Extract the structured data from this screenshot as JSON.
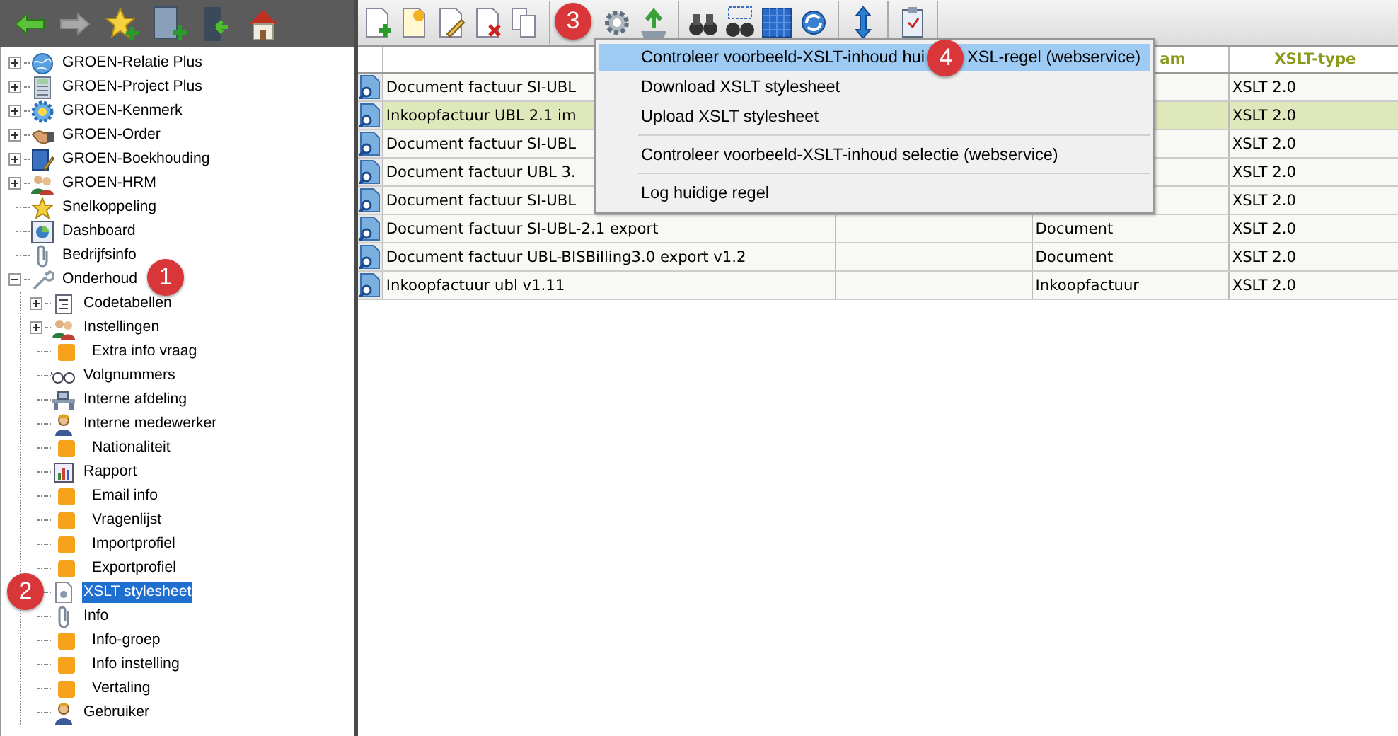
{
  "nav_toolbar": [
    {
      "disabled": false
    },
    {
      "disabled": true
    }
  ],
  "tree": [
    {
      "label": "GROEN-Relatie Plus",
      "expanded": false,
      "selected": false
    },
    {
      "label": "GROEN-Project Plus",
      "expanded": false,
      "selected": false
    },
    {
      "label": "GROEN-Kenmerk",
      "expanded": false,
      "selected": false
    },
    {
      "label": "GROEN-Order",
      "expanded": false,
      "selected": false
    },
    {
      "label": "GROEN-Boekhouding",
      "expanded": false,
      "selected": false
    },
    {
      "label": "GROEN-HRM",
      "expanded": false,
      "selected": false
    },
    {
      "label": "Snelkoppeling",
      "selected": false
    },
    {
      "label": "Dashboard",
      "selected": false
    },
    {
      "label": "Bedrijfsinfo",
      "selected": false
    },
    {
      "label": "Onderhoud",
      "expanded": true,
      "selected": false,
      "children": [
        {
          "label": "Codetabellen",
          "expanded": false,
          "selected": false
        },
        {
          "label": "Instellingen",
          "expanded": false,
          "selected": false
        },
        {
          "label": "Extra info vraag",
          "selected": false
        },
        {
          "label": "Volgnummers",
          "selected": false
        },
        {
          "label": "Interne afdeling",
          "selected": false
        },
        {
          "label": "Interne medewerker",
          "selected": false
        },
        {
          "label": "Nationaliteit",
          "selected": false
        },
        {
          "label": "Rapport",
          "selected": false
        },
        {
          "label": "Email info",
          "selected": false
        },
        {
          "label": "Vragenlijst",
          "selected": false
        },
        {
          "label": "Importprofiel",
          "selected": false
        },
        {
          "label": "Exportprofiel",
          "selected": false
        },
        {
          "label": "XSLT stylesheet",
          "selected": true
        },
        {
          "label": "Info",
          "selected": false
        },
        {
          "label": "Info-groep",
          "selected": false
        },
        {
          "label": "Info instelling",
          "selected": false
        },
        {
          "label": "Vertaling",
          "selected": false
        },
        {
          "label": "Gebruiker",
          "selected": false
        }
      ]
    }
  ],
  "grid": {
    "header": {
      "column_3": "am",
      "column_4": "XSLT-type"
    },
    "rows": [
      {
        "column_1": "Document factuur SI-UBL",
        "column_4": "XSLT 2.0",
        "selected": false
      },
      {
        "column_1": "Inkoopfactuur UBL 2.1 im",
        "column_4": "XSLT 2.0",
        "selected": true
      },
      {
        "column_1": "Document factuur SI-UBL",
        "column_4": "XSLT 2.0",
        "selected": false
      },
      {
        "column_1": "Document factuur UBL 3.",
        "column_4": "XSLT 2.0",
        "selected": false
      },
      {
        "column_1": "Document factuur SI-UBL",
        "column_4": "XSLT 2.0",
        "selected": false
      },
      {
        "column_1": "Document factuur SI-UBL-2.1 export",
        "column_3": "Document",
        "column_4": "XSLT 2.0",
        "selected": false
      },
      {
        "column_1": "Document factuur UBL-BISBilling3.0 export v1.2",
        "column_3": "Document",
        "column_4": "XSLT 2.0",
        "selected": false
      },
      {
        "column_1": "Inkoopfactuur ubl v1.11",
        "column_3": "Inkoopfactuur",
        "column_4": "XSLT 2.0",
        "selected": false
      }
    ]
  },
  "context_menu": [
    {
      "kind": "item",
      "label": "Controleer voorbeeld-XSLT-inhoud hui",
      "label_after_badge": "XSL-regel (webservice)",
      "selected": true
    },
    {
      "kind": "item",
      "label": "Download XSLT stylesheet",
      "selected": false
    },
    {
      "kind": "item",
      "label": "Upload XSLT stylesheet",
      "selected": false
    },
    {
      "kind": "separator"
    },
    {
      "kind": "item",
      "label": "Controleer voorbeeld-XSLT-inhoud selectie (webservice)",
      "selected": false
    },
    {
      "kind": "separator"
    },
    {
      "kind": "item",
      "label": "Log huidige regel",
      "selected": false
    }
  ],
  "annotations": [
    "1",
    "2",
    "3",
    "4"
  ]
}
